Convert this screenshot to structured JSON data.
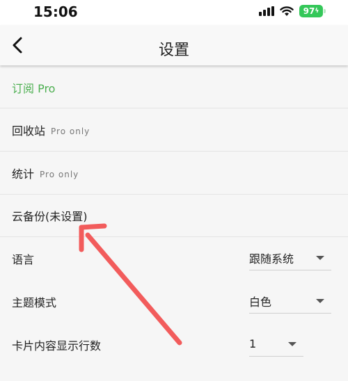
{
  "status_bar": {
    "time": "15:06",
    "battery": "97",
    "signal_icon": "signal-icon",
    "wifi_icon": "wifi-icon"
  },
  "nav": {
    "title": "设置",
    "back_icon": "chevron-left-icon"
  },
  "settings": {
    "subscribe": {
      "label": "订阅 Pro",
      "color": "#4caf50"
    },
    "recycle_bin": {
      "label": "回收站",
      "tag": "Pro only"
    },
    "statistics": {
      "label": "统计",
      "tag": "Pro only"
    },
    "cloud_backup": {
      "label": "云备份(未设置)"
    },
    "language": {
      "label": "语言",
      "value": "跟随系统"
    },
    "theme": {
      "label": "主题模式",
      "value": "白色"
    },
    "card_lines": {
      "label": "卡片内容显示行数",
      "value": "1"
    }
  },
  "annotation": {
    "color": "#f25c5c",
    "icon": "red-arrow"
  }
}
